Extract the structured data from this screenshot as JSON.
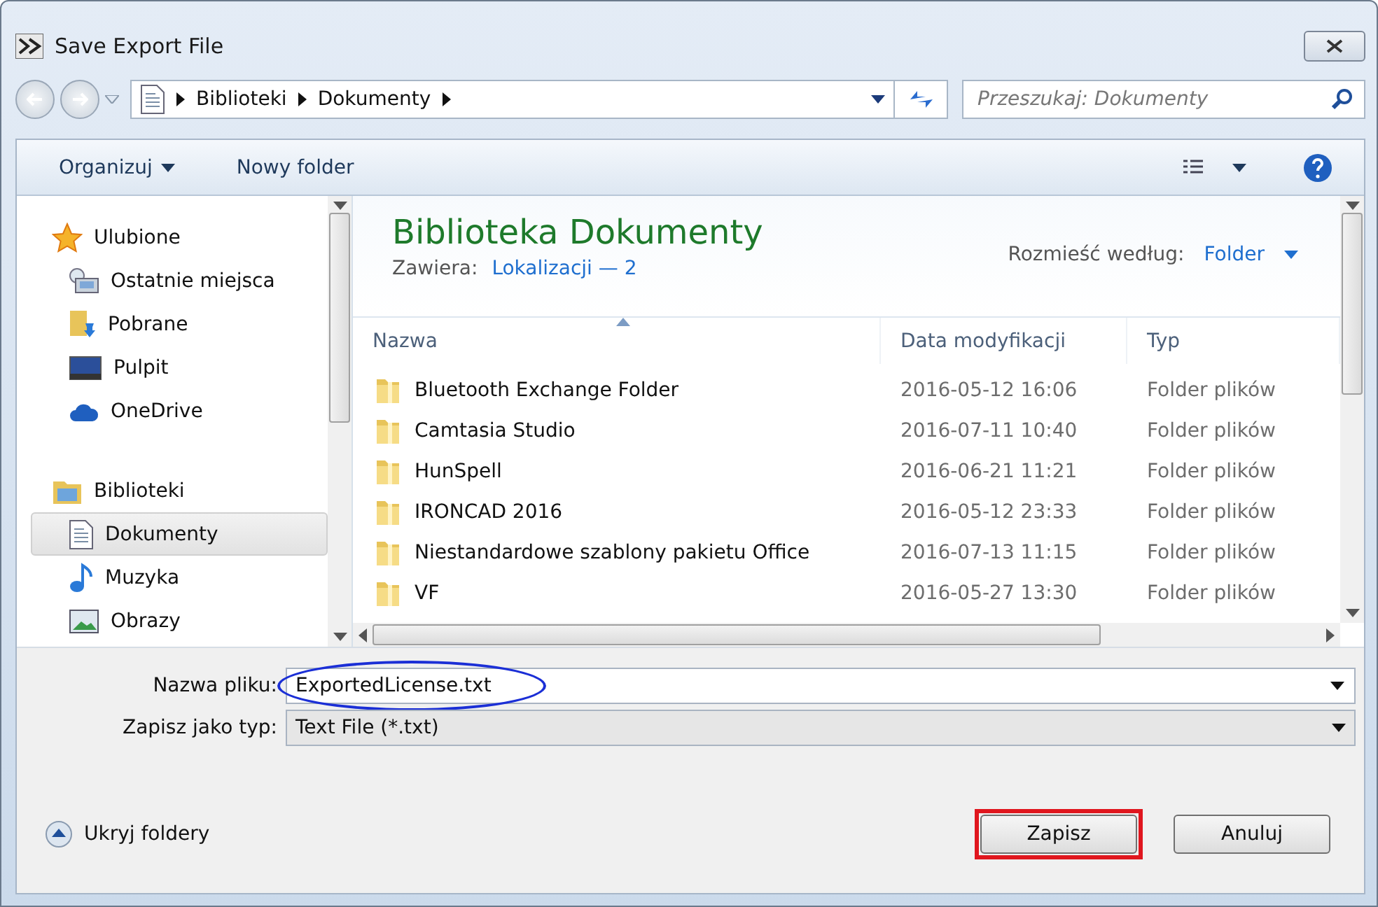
{
  "window": {
    "title": "Save Export File"
  },
  "address": {
    "path": [
      "Biblioteki",
      "Dokumenty"
    ],
    "search_placeholder": "Przeszukaj: Dokumenty"
  },
  "toolbar": {
    "organize": "Organizuj",
    "new_folder": "Nowy folder"
  },
  "nav": [
    {
      "label": "Ulubione",
      "kind": "star",
      "selected": false,
      "children": [
        {
          "label": "Ostatnie miejsca",
          "kind": "recent",
          "selected": false
        },
        {
          "label": "Pobrane",
          "kind": "download",
          "selected": false
        },
        {
          "label": "Pulpit",
          "kind": "desktop",
          "selected": false
        },
        {
          "label": "OneDrive",
          "kind": "cloud",
          "selected": false
        }
      ]
    },
    {
      "label": "Biblioteki",
      "kind": "library",
      "selected": false,
      "children": [
        {
          "label": "Dokumenty",
          "kind": "document",
          "selected": true
        },
        {
          "label": "Muzyka",
          "kind": "music",
          "selected": false
        },
        {
          "label": "Obrazy",
          "kind": "image",
          "selected": false
        }
      ]
    }
  ],
  "library": {
    "title": "Biblioteka Dokumenty",
    "contains_label": "Zawiera:",
    "contains_link": "Lokalizacji — 2",
    "arrange_label": "Rozmieść według:",
    "arrange_value": "Folder"
  },
  "columns": [
    {
      "label": "Nazwa",
      "sorted": true
    },
    {
      "label": "Data modyfikacji",
      "sorted": false
    },
    {
      "label": "Typ",
      "sorted": false
    }
  ],
  "rows": [
    {
      "name": "Bluetooth Exchange Folder",
      "date": "2016-05-12 16:06",
      "type": "Folder plików"
    },
    {
      "name": "Camtasia Studio",
      "date": "2016-07-11 10:40",
      "type": "Folder plików"
    },
    {
      "name": "HunSpell",
      "date": "2016-06-21 11:21",
      "type": "Folder plików"
    },
    {
      "name": "IRONCAD 2016",
      "date": "2016-05-12 23:33",
      "type": "Folder plików"
    },
    {
      "name": "Niestandardowe szablony pakietu Office",
      "date": "2016-07-13 11:15",
      "type": "Folder plików"
    },
    {
      "name": "VF",
      "date": "2016-05-27 13:30",
      "type": "Folder plików"
    }
  ],
  "fields": [
    {
      "label": "Nazwa pliku:",
      "value": "ExportedLicense.txt",
      "kind": "input",
      "circled": true
    },
    {
      "label": "Zapisz jako typ:",
      "value": "Text File (*.txt)",
      "kind": "select",
      "circled": false
    }
  ],
  "hide_folders": "Ukryj foldery",
  "buttons": [
    {
      "label": "Zapisz",
      "framed": true
    },
    {
      "label": "Anuluj",
      "framed": false
    }
  ]
}
